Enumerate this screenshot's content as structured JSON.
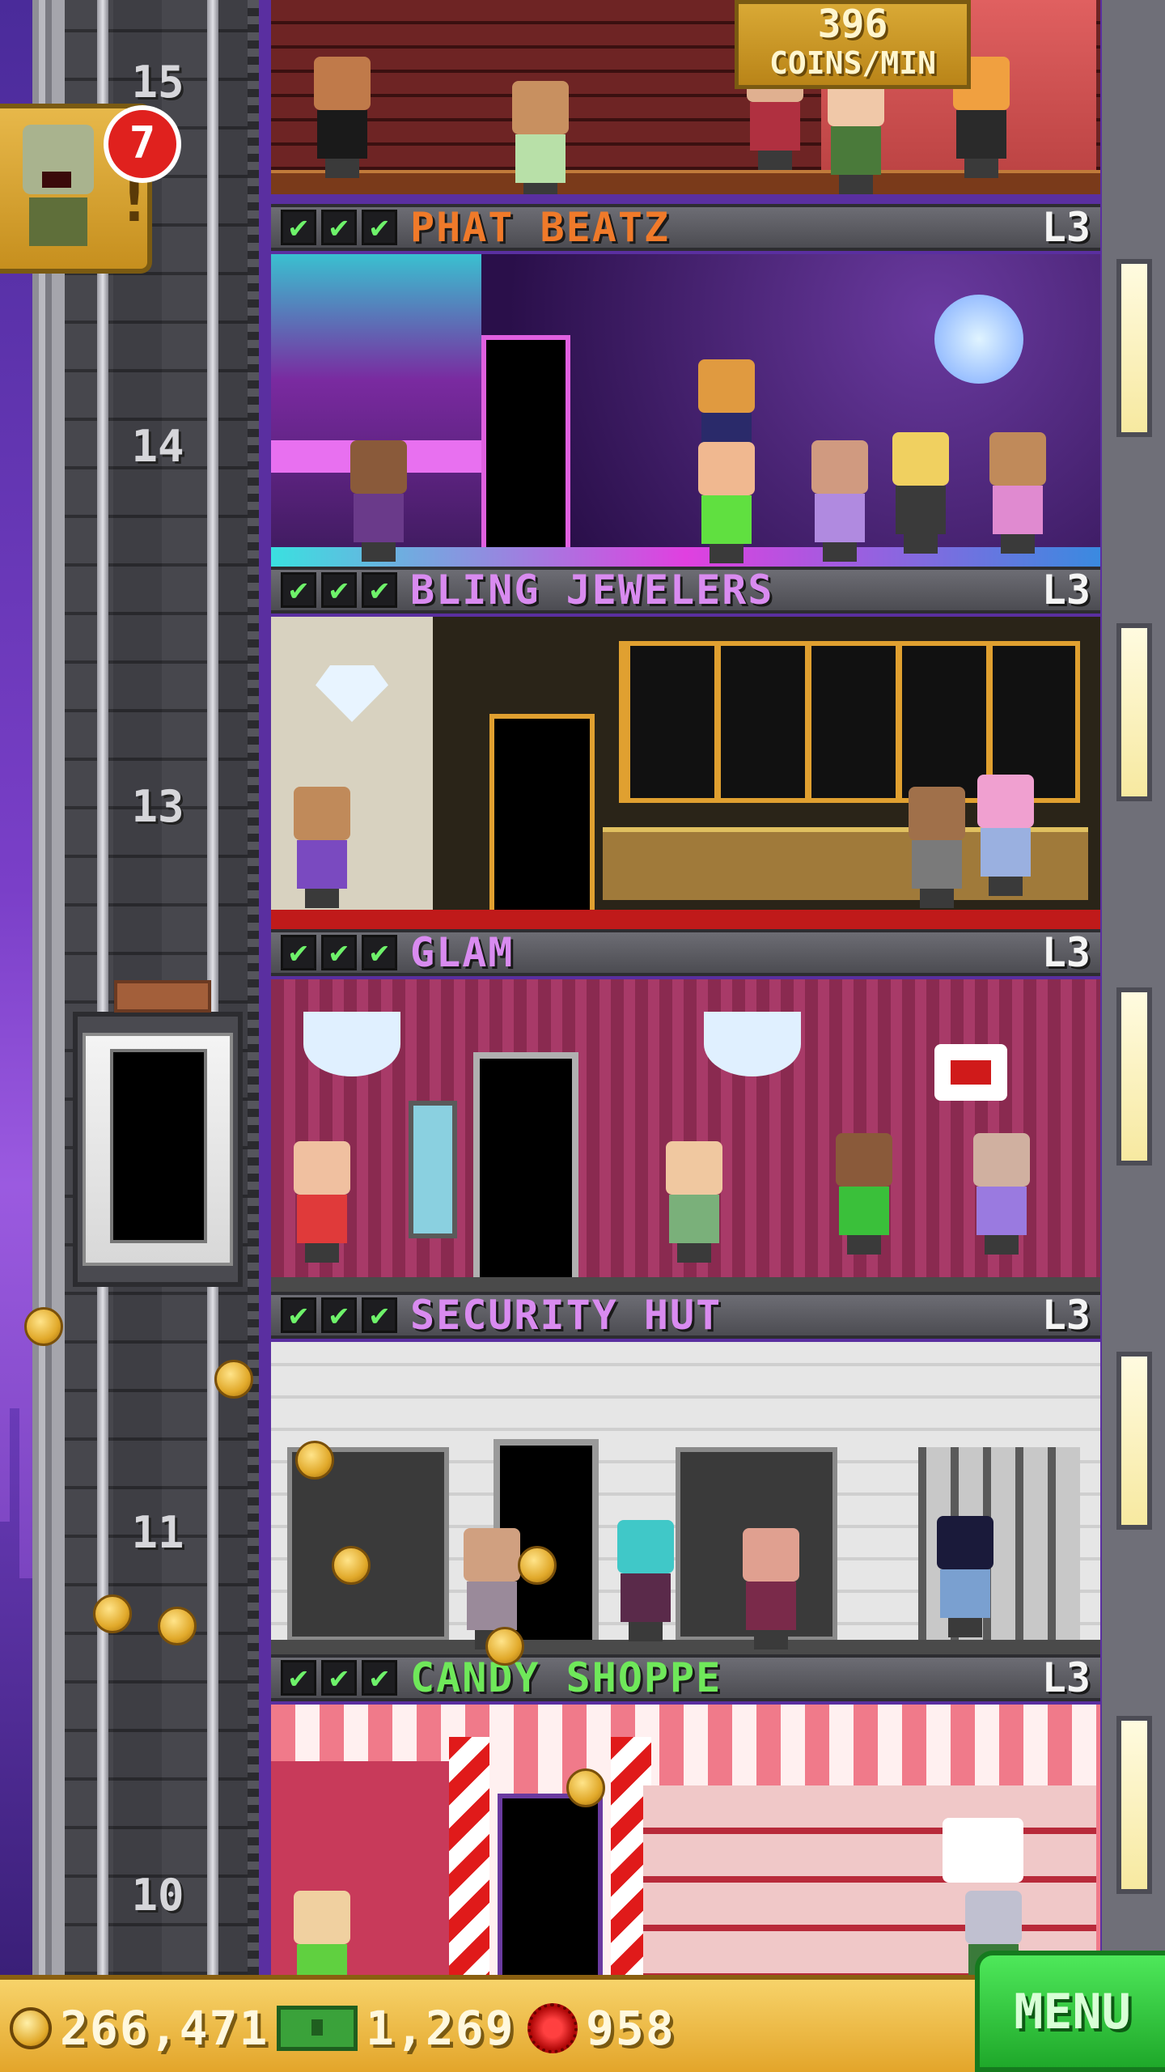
{
  "game": {
    "top_floor": {
      "coins_amount": "396",
      "coins_label": "COINS/MIN"
    },
    "notification": {
      "count": "7",
      "alert": "!"
    },
    "floor_numbers": [
      "15",
      "14",
      "13",
      "11",
      "10"
    ],
    "floors": [
      {
        "name": "PHAT BEATZ",
        "level": "L3",
        "color": "#f07a2a"
      },
      {
        "name": "BLING JEWELERS",
        "level": "L3",
        "color": "#d98bf0"
      },
      {
        "name": "GLAM",
        "level": "L3",
        "color": "#d98bf0"
      },
      {
        "name": "SECURITY HUT",
        "level": "L3",
        "color": "#d98bf0"
      },
      {
        "name": "CANDY SHOPPE",
        "level": "L3",
        "color": "#6fe85a"
      }
    ],
    "check_mark": "✔"
  },
  "bottom_bar": {
    "coins": "266,471",
    "bux": "1,269",
    "gems": "958",
    "menu_label": "MENU"
  }
}
